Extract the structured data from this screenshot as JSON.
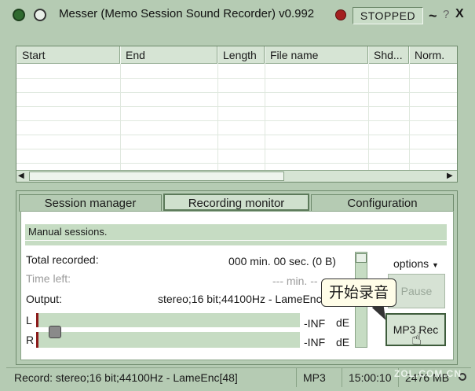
{
  "window": {
    "title": "Messer (Memo Session Sound Recorder) v0.992",
    "status": "STOPPED",
    "controls": {
      "minimize": "~",
      "help": "?",
      "close": "X"
    }
  },
  "table": {
    "columns": [
      "Start",
      "End",
      "Length",
      "File name",
      "Shd...",
      "Norm."
    ],
    "rows": []
  },
  "tabs": [
    {
      "label": "Session manager"
    },
    {
      "label": "Recording monitor",
      "active": true
    },
    {
      "label": "Configuration"
    }
  ],
  "monitor": {
    "mode_text": "Manual sessions.",
    "total_label": "Total recorded:",
    "total_value": "000 min. 00 sec. (0 B)",
    "time_left_label": "Time left:",
    "time_left_value": "--- min. --",
    "output_label": "Output:",
    "output_value": "stereo;16 bit;44100Hz - LameEnc",
    "options_label": "options",
    "channel_l": "L",
    "channel_r": "R",
    "level_l": "-INF",
    "level_r": "-INF",
    "unit_l": "dE",
    "unit_r": "dE",
    "pause_label": "Pause",
    "rec_label": "MP3 Rec",
    "callout": "开始录音"
  },
  "statusbar": {
    "record": "Record: stereo;16 bit;44100Hz - LameEnc[48]",
    "format": "MP3",
    "time": "15:00:10",
    "size": "2476 MB"
  },
  "watermark": "ZOL.COM.CN"
}
